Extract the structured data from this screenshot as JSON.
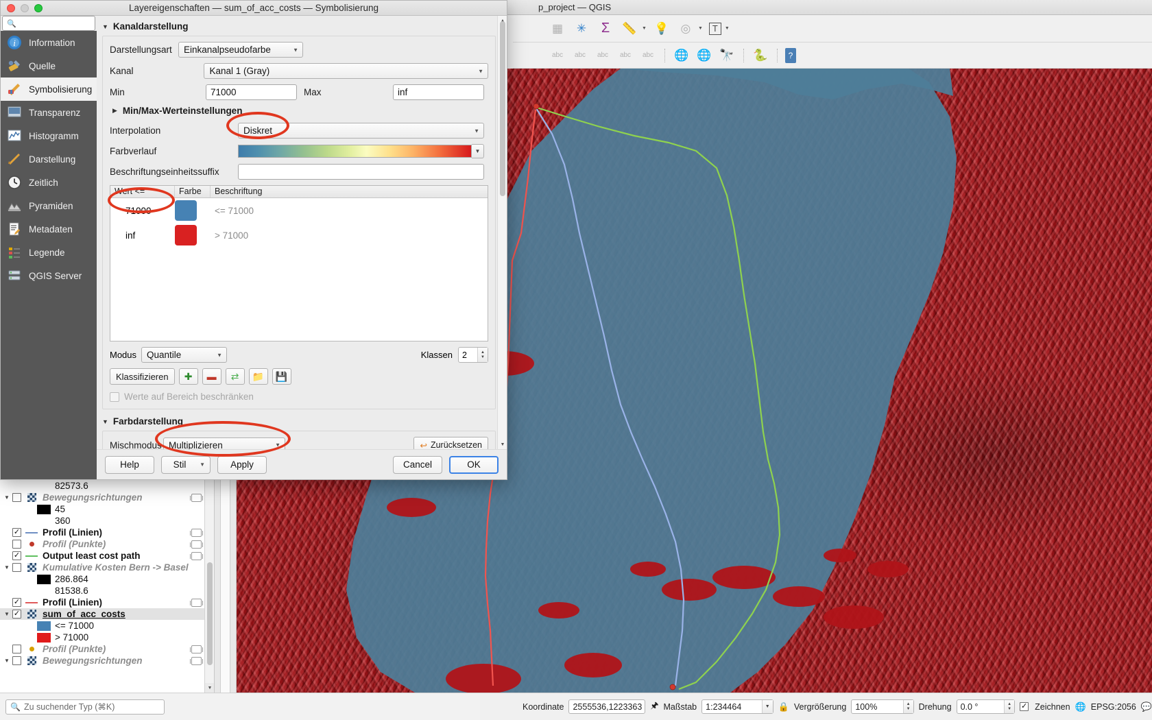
{
  "qgis": {
    "window_title": "p_project — QGIS",
    "toolbar_row1": [
      {
        "name": "attribute-table-icon",
        "glyph": "▦"
      },
      {
        "name": "field-calculator-icon",
        "glyph": "✳"
      },
      {
        "name": "statistics-icon",
        "glyph": "Σ"
      },
      {
        "name": "measure-icon",
        "glyph": "📏"
      },
      {
        "name": "map-tips-icon",
        "glyph": "💬"
      },
      {
        "name": "annotation-icon",
        "glyph": "◎"
      },
      {
        "name": "text-annotation-icon",
        "glyph": "T"
      }
    ],
    "toolbar_row2": [
      {
        "name": "label-abc-icon",
        "glyph": "abc"
      },
      {
        "name": "label-hide-icon",
        "glyph": "abc"
      },
      {
        "name": "label-move-icon",
        "glyph": "abc"
      },
      {
        "name": "label-rotate-icon",
        "glyph": "abc"
      },
      {
        "name": "label-change-icon",
        "glyph": "abc"
      },
      {
        "name": "add-wms-icon",
        "glyph": "🌐"
      },
      {
        "name": "wms-layer-icon",
        "glyph": "🌐"
      },
      {
        "name": "metasearch-icon",
        "glyph": "🔭"
      },
      {
        "name": "python-console-icon",
        "glyph": "🐍"
      },
      {
        "name": "help-icon",
        "glyph": "?"
      }
    ]
  },
  "dialog": {
    "title": "Layereigenschaften  — sum_of_acc_costs — Symbolisierung",
    "search_placeholder": "",
    "sidebar": [
      {
        "label": "Information",
        "icon": "info-icon",
        "active": false
      },
      {
        "label": "Quelle",
        "icon": "source-icon",
        "active": false
      },
      {
        "label": "Symbolisierung",
        "icon": "symbology-brush-icon",
        "active": true
      },
      {
        "label": "Transparenz",
        "icon": "transparency-icon",
        "active": false
      },
      {
        "label": "Histogramm",
        "icon": "histogram-icon",
        "active": false
      },
      {
        "label": "Darstellung",
        "icon": "rendering-brush-icon",
        "active": false
      },
      {
        "label": "Zeitlich",
        "icon": "clock-icon",
        "active": false
      },
      {
        "label": "Pyramiden",
        "icon": "pyramids-icon",
        "active": false
      },
      {
        "label": "Metadaten",
        "icon": "metadata-icon",
        "active": false
      },
      {
        "label": "Legende",
        "icon": "legend-icon",
        "active": false
      },
      {
        "label": "QGIS Server",
        "icon": "server-icon",
        "active": false
      }
    ],
    "band_rendering": {
      "group_title": "Kanaldarstellung",
      "render_type_label": "Darstellungsart",
      "render_type_value": "Einkanalpseudofarbe",
      "band_label": "Kanal",
      "band_value": "Kanal 1 (Gray)",
      "min_label": "Min",
      "min_value": "71000",
      "max_label": "Max",
      "max_value": "inf",
      "minmax_settings_label": "Min/Max-Werteinstellungen",
      "interpolation_label": "Interpolation",
      "interpolation_value": "Diskret",
      "colorramp_label": "Farbverlauf",
      "label_unit_suffix_label": "Beschriftungseinheitssuffix",
      "label_unit_suffix_value": "",
      "table_headers": [
        "Wert <=",
        "Farbe",
        "Beschriftung"
      ],
      "classes": [
        {
          "value": "71000",
          "color": "#4682b4",
          "label": "<= 71000"
        },
        {
          "value": "inf",
          "color": "#d92121",
          "label": "> 71000"
        }
      ],
      "mode_label": "Modus",
      "mode_value": "Quantile",
      "classes_label": "Klassen",
      "classes_count": "2",
      "classify_button": "Klassifizieren",
      "tool_buttons": [
        {
          "name": "add-class-button",
          "glyph": "✚"
        },
        {
          "name": "remove-class-button",
          "glyph": "▬"
        },
        {
          "name": "sort-classes-button",
          "glyph": "⇄"
        },
        {
          "name": "load-classes-button",
          "glyph": "📁"
        },
        {
          "name": "save-classes-button",
          "glyph": "💾"
        }
      ],
      "clip_checkbox_label": "Werte auf Bereich beschränken"
    },
    "color_rendering": {
      "group_title": "Farbdarstellung",
      "blend_label": "Mischmodus",
      "blend_value": "Multiplizieren",
      "reset_label": "Zurücksetzen"
    },
    "buttons": {
      "help": "Help",
      "style": "Stil",
      "apply": "Apply",
      "cancel": "Cancel",
      "ok": "OK"
    }
  },
  "layers": {
    "rows": [
      {
        "indent": 1,
        "expander": "",
        "checkbox": "none",
        "symbol": "none",
        "label": "82573.6",
        "style": "plain"
      },
      {
        "indent": 0,
        "expander": "▼",
        "checkbox": "off",
        "symbol": "raster",
        "label": "Bewegungsrichtungen",
        "style": "italic-grey",
        "chip": true
      },
      {
        "indent": 1,
        "expander": "",
        "checkbox": "none",
        "symbol": "swatch",
        "color": "#000000",
        "label": "45",
        "style": "plain"
      },
      {
        "indent": 1,
        "expander": "",
        "checkbox": "none",
        "symbol": "none",
        "label": "360",
        "style": "plain"
      },
      {
        "indent": 0,
        "expander": "",
        "checkbox": "on",
        "symbol": "line",
        "color": "#6f8fc4",
        "label": "Profil (Linien)",
        "style": "bold",
        "chip": true
      },
      {
        "indent": 0,
        "expander": "",
        "checkbox": "off",
        "symbol": "dot",
        "color": "#c0392b",
        "label": "Profil (Punkte)",
        "style": "italic-grey",
        "chip": true
      },
      {
        "indent": 0,
        "expander": "",
        "checkbox": "on",
        "symbol": "line",
        "color": "#5fbf5f",
        "label": "Output least cost path",
        "style": "bold",
        "chip": true
      },
      {
        "indent": 0,
        "expander": "▼",
        "checkbox": "off",
        "symbol": "raster",
        "label": "Kumulative Kosten Bern -> Basel",
        "style": "italic-grey"
      },
      {
        "indent": 1,
        "expander": "",
        "checkbox": "none",
        "symbol": "swatch",
        "color": "#000000",
        "label": "286.864",
        "style": "plain"
      },
      {
        "indent": 1,
        "expander": "",
        "checkbox": "none",
        "symbol": "none",
        "label": "81538.6",
        "style": "plain"
      },
      {
        "indent": 0,
        "expander": "",
        "checkbox": "on",
        "symbol": "line",
        "color": "#e05a5a",
        "label": "Profil (Linien)",
        "style": "bold",
        "chip": true
      },
      {
        "indent": 0,
        "expander": "▼",
        "checkbox": "on",
        "symbol": "raster",
        "label": "sum_of_acc_costs",
        "style": "active",
        "selected": true
      },
      {
        "indent": 1,
        "expander": "",
        "checkbox": "none",
        "symbol": "swatch",
        "color": "#4682b4",
        "label": "<= 71000",
        "style": "plain"
      },
      {
        "indent": 1,
        "expander": "",
        "checkbox": "none",
        "symbol": "swatch",
        "color": "#e01b1b",
        "label": "> 71000",
        "style": "plain"
      },
      {
        "indent": 0,
        "expander": "",
        "checkbox": "off",
        "symbol": "dot",
        "color": "#d6a000",
        "label": "Profil (Punkte)",
        "style": "italic-grey",
        "chip": true
      },
      {
        "indent": 0,
        "expander": "▼",
        "checkbox": "off",
        "symbol": "raster",
        "label": "Bewegungsrichtungen",
        "style": "italic-grey",
        "chip": true
      }
    ]
  },
  "locator": {
    "placeholder": "Zu suchender Typ (⌘K)"
  },
  "statusbar": {
    "coordinate_label": "Koordinate",
    "coordinate_value": "2555536,1223363",
    "scale_label": "Maßstab",
    "scale_value": "1:234464",
    "magnifier_label": "Vergrößerung",
    "magnifier_value": "100%",
    "rotation_label": "Drehung",
    "rotation_value": "0.0 °",
    "render_label": "Zeichnen",
    "crs_label": "EPSG:2056"
  },
  "map": {
    "accent_red": "#b01419",
    "accent_blue": "#4e7e99",
    "route_red": "#f2544e",
    "route_blue": "#9ab3e8",
    "route_green": "#8fd24e"
  }
}
